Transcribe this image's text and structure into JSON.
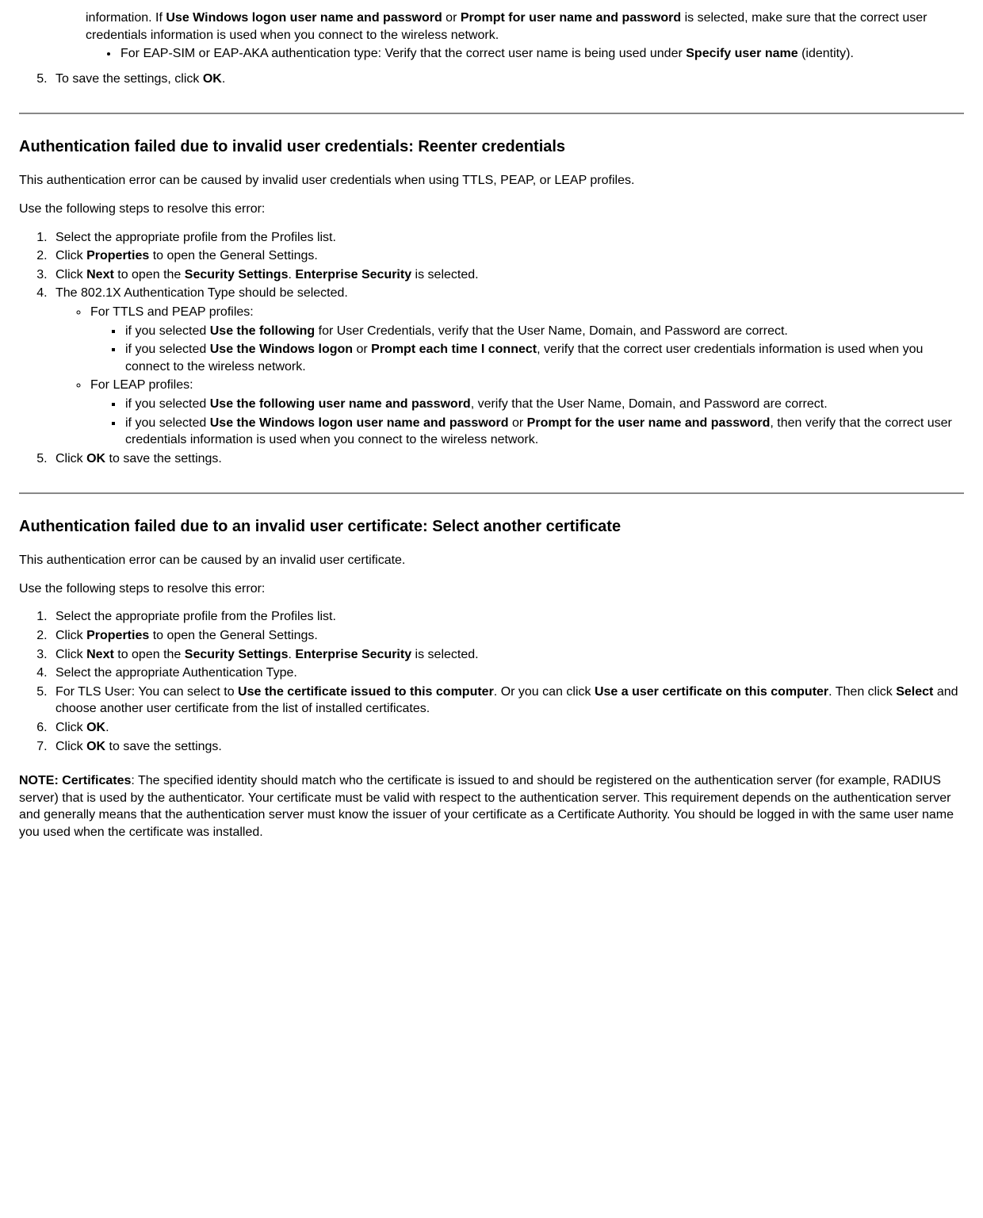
{
  "topFragment": {
    "part1": "information. If ",
    "bold1": "Use Windows logon user name and password",
    "mid1": " or ",
    "bold2": "Prompt for user name and password",
    "part2": " is selected, make sure that the correct user credentials information is used when you connect to the wireless network.",
    "bullet2a": "For EAP-SIM or EAP-AKA authentication type: Verify that the correct user name is being used under ",
    "bullet2b": "Specify user name",
    "bullet2c": " (identity)."
  },
  "topStep5": {
    "a": "To save the settings, click ",
    "b": "OK",
    "c": "."
  },
  "sec1": {
    "heading": "Authentication failed due to invalid user credentials: Reenter credentials",
    "intro": "This authentication error can be caused by invalid user credentials when using TTLS, PEAP, or LEAP profiles.",
    "lead": "Use the following steps to resolve this error:",
    "s1": "Select the appropriate profile from the Profiles list.",
    "s2": {
      "a": "Click ",
      "b": "Properties",
      "c": " to open the General Settings."
    },
    "s3": {
      "a": "Click ",
      "b": "Next",
      "c": " to open the ",
      "d": "Security Settings",
      "e": ". ",
      "f": "Enterprise Security",
      "g": " is selected."
    },
    "s4": "The 802.1X Authentication Type should be selected.",
    "s4a_label": "For TTLS and PEAP profiles:",
    "s4a_i": {
      "a": "if you selected ",
      "b": "Use the following",
      "c": " for User Credentials, verify that the User Name, Domain, and Password are correct."
    },
    "s4a_ii": {
      "a": "if you selected ",
      "b": "Use the Windows logon",
      "c": " or ",
      "d": "Prompt each time I connect",
      "e": ", verify that the correct user credentials information is used when you connect to the wireless network."
    },
    "s4b_label": "For LEAP profiles:",
    "s4b_i": {
      "a": "if you selected ",
      "b": "Use the following user name and password",
      "c": ", verify that the User Name, Domain, and Password are correct."
    },
    "s4b_ii": {
      "a": "if you selected ",
      "b": "Use the Windows logon user name and password",
      "c": " or ",
      "d": "Prompt for the user name and password",
      "e": ", then verify that the correct user credentials information is used when you connect to the wireless network."
    },
    "s5": {
      "a": "Click ",
      "b": "OK",
      "c": " to save the settings."
    }
  },
  "sec2": {
    "heading": "Authentication failed due to an invalid user certificate: Select another certificate",
    "intro": "This authentication error can be caused by an invalid user certificate.",
    "lead": "Use the following steps to resolve this error:",
    "s1": "Select the appropriate profile from the Profiles list.",
    "s2": {
      "a": "Click ",
      "b": "Properties",
      "c": " to open the General Settings."
    },
    "s3": {
      "a": "Click ",
      "b": "Next",
      "c": " to open the ",
      "d": "Security Settings",
      "e": ". ",
      "f": "Enterprise Security",
      "g": " is selected."
    },
    "s4": "Select the appropriate Authentication Type.",
    "s5": {
      "a": "For TLS User: You can select to ",
      "b": "Use the certificate issued to this computer",
      "c": ". Or you can click ",
      "d": "Use a user certificate on this computer",
      "e": ". Then click ",
      "f": "Select",
      "g": " and choose another user certificate from the list of installed certificates."
    },
    "s6": {
      "a": "Click ",
      "b": "OK",
      "c": "."
    },
    "s7": {
      "a": "Click ",
      "b": "OK",
      "c": " to save the settings."
    },
    "note": {
      "a": "NOTE: Certificates",
      "b": ": The specified identity should match who the certificate is issued to and should be registered on the authentication server (for example, RADIUS server) that is used by the authenticator. Your certificate must be valid with respect to the authentication server. This requirement depends on the authentication server and generally means that the authentication server must know the issuer of your certificate as a Certificate Authority. You should be logged in with the same user name you used when the certificate was installed."
    }
  }
}
